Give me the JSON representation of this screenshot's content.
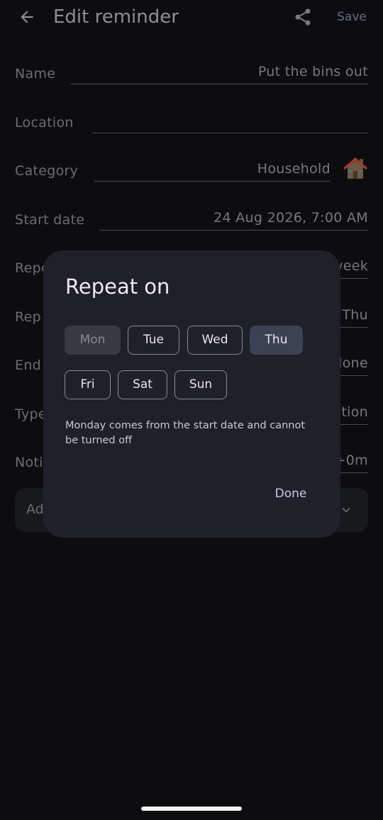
{
  "appbar": {
    "title": "Edit reminder",
    "save_label": "Save",
    "back_icon": "arrow-back-icon",
    "share_icon": "share-icon"
  },
  "form": {
    "name": {
      "label": "Name",
      "value": "Put the bins out"
    },
    "location": {
      "label": "Location",
      "value": ""
    },
    "category": {
      "label": "Category",
      "value": "Household",
      "icon": "house-icon"
    },
    "start_date": {
      "label": "Start date",
      "value": "24 Aug 2026, 7:00 AM"
    },
    "repeat": {
      "label": "Repe",
      "value": "week"
    },
    "repeat_on": {
      "label": "Rep",
      "value": "Thu"
    },
    "ends": {
      "label": "End",
      "value": "lone"
    },
    "type": {
      "label": "Type",
      "value": "tion"
    },
    "notify": {
      "label": "Noti",
      "value": "+0m"
    },
    "advanced": {
      "label": "Ad",
      "icon": "chevron-down-icon"
    }
  },
  "dialog": {
    "title": "Repeat on",
    "days": [
      {
        "label": "Mon",
        "state": "disabled"
      },
      {
        "label": "Tue",
        "state": "unselected"
      },
      {
        "label": "Wed",
        "state": "unselected"
      },
      {
        "label": "Thu",
        "state": "selected"
      },
      {
        "label": "Fri",
        "state": "unselected"
      },
      {
        "label": "Sat",
        "state": "unselected"
      },
      {
        "label": "Sun",
        "state": "unselected"
      }
    ],
    "note": "Monday comes from the start date and cannot be turned off",
    "done_label": "Done"
  },
  "colors": {
    "background": "#0d0d10",
    "dialog_surface": "#1f2028",
    "chip_selected": "#3d4154",
    "accent_text": "#c5c9e8"
  }
}
